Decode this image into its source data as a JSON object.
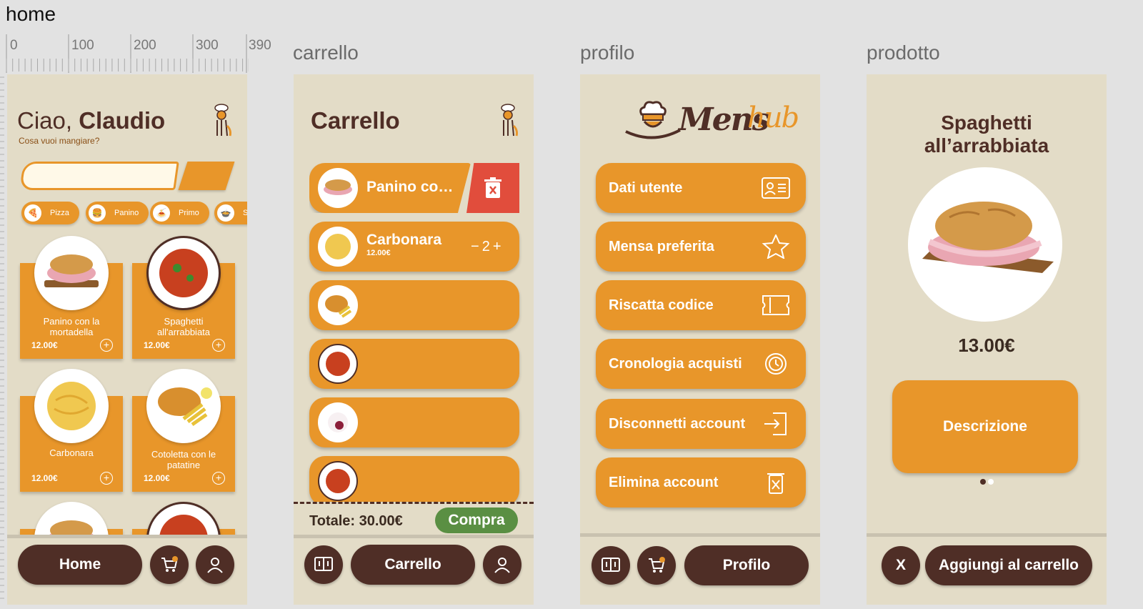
{
  "frames": {
    "home": "home",
    "carrello": "carrello",
    "profilo": "profilo",
    "prodotto": "prodotto"
  },
  "ruler": [
    "0",
    "100",
    "200",
    "300",
    "390"
  ],
  "home": {
    "greeting": "Ciao,",
    "name": "Claudio",
    "subtitle": "Cosa vuoi mangiare?",
    "search_placeholder": "",
    "categories": [
      "Pizza",
      "Panino",
      "Primo",
      "S"
    ],
    "products": [
      {
        "name": "Panino con la mortadella",
        "price": "12.00€"
      },
      {
        "name": "Spaghetti all'arrabbiata",
        "price": "12.00€"
      },
      {
        "name": "Carbonara",
        "price": "12.00€"
      },
      {
        "name": "Cotoletta con le patatine",
        "price": "12.00€"
      }
    ],
    "nav_home": "Home"
  },
  "carrello": {
    "title": "Carrello",
    "items": [
      {
        "name": "Panino co…"
      },
      {
        "name": "Carbonara",
        "price": "12.00€",
        "minus": "−",
        "qty": "2",
        "plus": "+"
      }
    ],
    "total": "Totale: 30.00€",
    "buy": "Compra",
    "nav_cart": "Carrello"
  },
  "profilo": {
    "logo_a": "Mens",
    "logo_b": "hub",
    "buttons": [
      "Dati utente",
      "Mensa preferita",
      "Riscatta codice",
      "Cronologia acquisti",
      "Disconnetti account",
      "Elimina account"
    ],
    "icons": [
      "id-card-icon",
      "star-icon",
      "ticket-icon",
      "history-icon",
      "logout-icon",
      "trash-icon"
    ],
    "nav_profile": "Profilo"
  },
  "prodotto": {
    "title": "Spaghetti all’arrabbiata",
    "price": "13.00€",
    "description": "Descrizione",
    "close": "X",
    "add": "Aggiungi al carrello"
  },
  "colors": {
    "background": "#e3dcc7",
    "accent": "#e8962a",
    "brown": "#4f2e26",
    "danger": "#e14d3c",
    "success": "#5a8f43"
  }
}
